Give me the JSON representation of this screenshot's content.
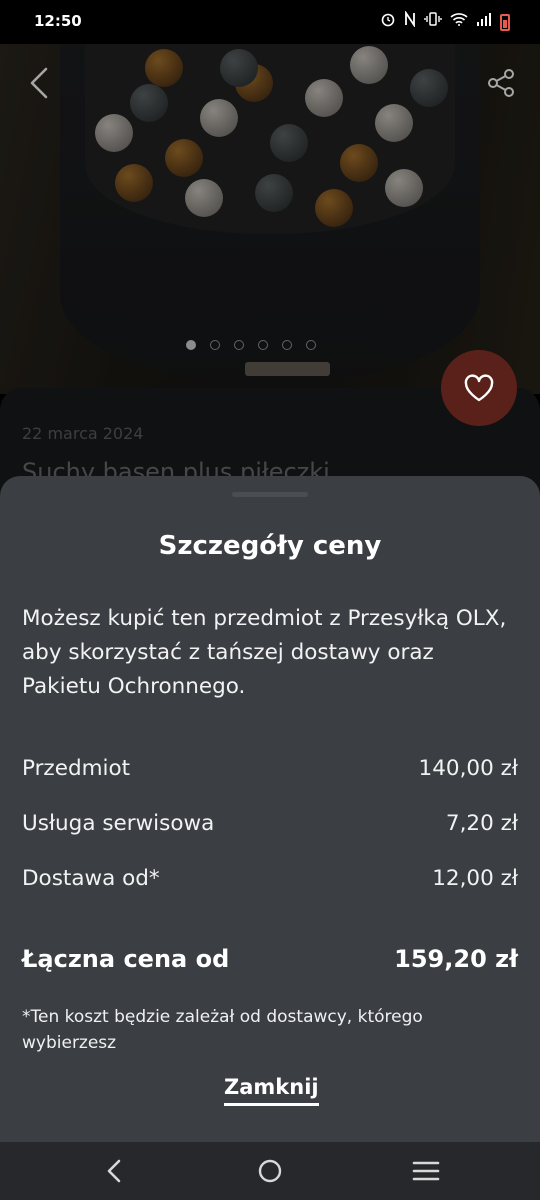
{
  "status_bar": {
    "time": "12:50",
    "icons": [
      "alarm-icon",
      "nfc-icon",
      "vibrate-icon",
      "wifi-icon",
      "signal-icon",
      "battery-icon"
    ]
  },
  "gallery": {
    "image_count": 6,
    "active_index": 0,
    "description": "ball pit pool with white, gold and grey balls"
  },
  "listing": {
    "date": "22 marca 2024",
    "title": "Suchy basen plus piłeczki"
  },
  "sheet": {
    "title": "Szczegóły ceny",
    "description": "Możesz kupić ten przedmiot z Przesyłką OLX, aby skorzystać z tańszej dostawy oraz Pakietu Ochronnego.",
    "rows": [
      {
        "label": "Przedmiot",
        "value": "140,00 zł"
      },
      {
        "label": "Usługa serwisowa",
        "value": "7,20 zł"
      },
      {
        "label": "Dostawa od*",
        "value": "12,00 zł"
      }
    ],
    "total_label": "Łączna cena od",
    "total_value": "159,20 zł",
    "footnote": "*Ten koszt będzie zależał od dostawcy, którego wybierzesz",
    "close_label": "Zamknij"
  },
  "colors": {
    "sheet_bg": "#3b3e43",
    "fav_bg": "#5a211b",
    "battery": "#e85a50"
  }
}
